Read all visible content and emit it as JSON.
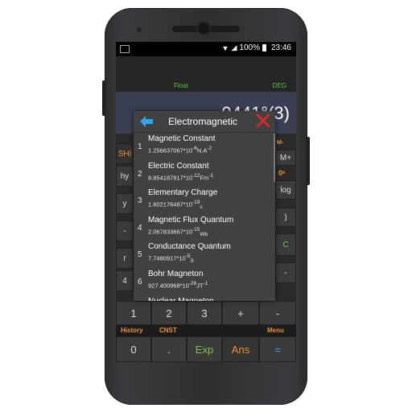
{
  "status_bar": {
    "battery": "100%",
    "time": "23:46"
  },
  "display": {
    "mode": "Float",
    "angle_unit": "DEG",
    "expression": "… 0441°(3)"
  },
  "dialog": {
    "title": "Electromagnetic",
    "constants": [
      {
        "index": "1",
        "name": "Magnetic Constant",
        "mantissa": "1.256637067*10",
        "exponent": "-6",
        "unit": "N.A",
        "unit_sup": "-2",
        "unit_sub": ""
      },
      {
        "index": "2",
        "name": "Electric Constant",
        "mantissa": "8.854187817*10",
        "exponent": "-12",
        "unit": "Fm",
        "unit_sup": "-1",
        "unit_sub": ""
      },
      {
        "index": "3",
        "name": "Elementary Charge",
        "mantissa": "1.602176487*10",
        "exponent": "-19",
        "unit": "",
        "unit_sup": "",
        "unit_sub": "c"
      },
      {
        "index": "4",
        "name": "Magnetic Flux Quantum",
        "mantissa": "2.067833667*10",
        "exponent": "-15",
        "unit": "",
        "unit_sup": "",
        "unit_sub": "Wb"
      },
      {
        "index": "5",
        "name": "Conductance Quantum",
        "mantissa": "7.7480917*10",
        "exponent": "-5",
        "unit": "",
        "unit_sup": "",
        "unit_sub": "S"
      },
      {
        "index": "6",
        "name": "Bohr Magneton",
        "mantissa": "927.400968*10",
        "exponent": "-26",
        "unit": "JT",
        "unit_sup": "-1",
        "unit_sub": ""
      },
      {
        "index": "7",
        "name": "Nuclear Magneton",
        "mantissa": "",
        "exponent": "",
        "unit": "",
        "unit_sup": "",
        "unit_sub": ""
      }
    ]
  },
  "keypad": {
    "row_num": [
      "1",
      "2",
      "3",
      "+",
      "-"
    ],
    "labels": {
      "history": "History",
      "cnst": "CNST",
      "menu": "Menu"
    },
    "row_bottom": [
      "0",
      ".",
      "Exp",
      "Ans",
      "="
    ],
    "partial": {
      "shift": "SHI",
      "hyp": "hy",
      "mem_minus": "M-",
      "mem_plus": "M+",
      "zero_x": "0ˣ",
      "log": "log",
      "paren": ")",
      "c_key": "C"
    }
  },
  "colors": {
    "accent_orange": "#f0932b",
    "accent_green": "#5cc33c",
    "accent_blue": "#2aa6e6",
    "close_red": "#d22a2a"
  }
}
